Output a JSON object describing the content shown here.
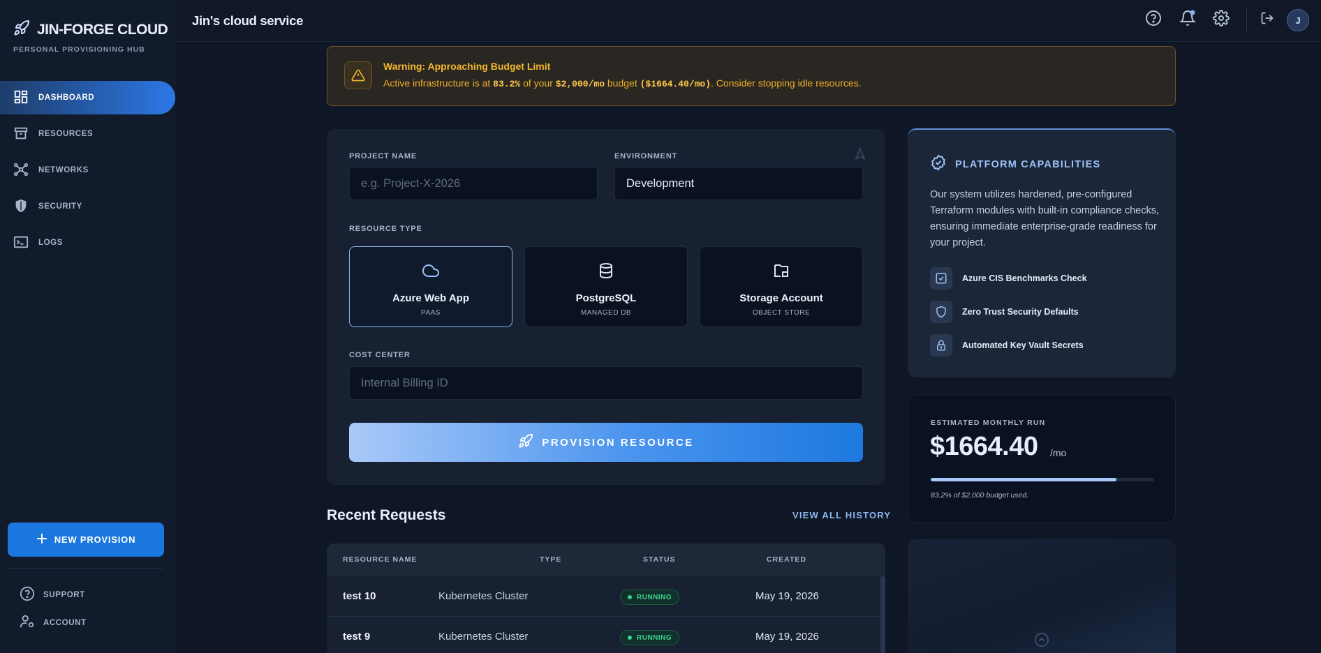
{
  "app": {
    "brand_title": "JIN-FORGE CLOUD",
    "brand_subtitle": "PERSONAL PROVISIONING HUB",
    "header_title": "Jin's cloud service",
    "avatar_initial": "J"
  },
  "sidebar": {
    "items": [
      {
        "label": "DASHBOARD",
        "icon": "dashboard-icon",
        "active": true
      },
      {
        "label": "RESOURCES",
        "icon": "archive-icon",
        "active": false
      },
      {
        "label": "NETWORKS",
        "icon": "network-icon",
        "active": false
      },
      {
        "label": "SECURITY",
        "icon": "shield-icon",
        "active": false
      },
      {
        "label": "LOGS",
        "icon": "terminal-icon",
        "active": false
      }
    ],
    "new_provision": "NEW PROVISION",
    "support": "SUPPORT",
    "account": "ACCOUNT"
  },
  "warning": {
    "title": "Warning: Approaching Budget Limit",
    "text_1": "Active infrastructure is at ",
    "percent": "83.2%",
    "text_2": " of your ",
    "budget": "$2,000/mo",
    "text_3": " budget ",
    "current": "($1664.40/mo)",
    "text_4": ". Consider stopping idle resources."
  },
  "form": {
    "project_label": "PROJECT NAME",
    "project_placeholder": "e.g. Project-X-2026",
    "env_label": "ENVIRONMENT",
    "env_value": "Development",
    "resource_type_label": "RESOURCE TYPE",
    "resource_types": [
      {
        "name": "Azure Web App",
        "sub": "PAAS",
        "selected": true,
        "icon": "cloud-icon"
      },
      {
        "name": "PostgreSQL",
        "sub": "MANAGED DB",
        "selected": false,
        "icon": "database-icon"
      },
      {
        "name": "Storage Account",
        "sub": "OBJECT STORE",
        "selected": false,
        "icon": "folder-icon"
      }
    ],
    "cost_center_label": "COST CENTER",
    "cost_center_placeholder": "Internal Billing ID",
    "submit_label": "PROVISION RESOURCE"
  },
  "recent": {
    "title": "Recent Requests",
    "view_all": "VIEW ALL HISTORY",
    "columns": [
      "RESOURCE NAME",
      "TYPE",
      "STATUS",
      "CREATED"
    ],
    "rows": [
      {
        "name": "test 10",
        "type": "Kubernetes Cluster",
        "status": "RUNNING",
        "created": "May 19, 2026"
      },
      {
        "name": "test 9",
        "type": "Kubernetes Cluster",
        "status": "RUNNING",
        "created": "May 19, 2026"
      }
    ]
  },
  "capabilities": {
    "title": "PLATFORM CAPABILITIES",
    "description": "Our system utilizes hardened, pre-configured Terraform modules with built-in compliance checks, ensuring immediate enterprise-grade readiness for your project.",
    "items": [
      {
        "label": "Azure CIS Benchmarks Check",
        "icon": "checkbox-icon"
      },
      {
        "label": "Zero Trust Security Defaults",
        "icon": "shield-outline-icon"
      },
      {
        "label": "Automated Key Vault Secrets",
        "icon": "lock-icon"
      }
    ]
  },
  "cost": {
    "label": "ESTIMATED MONTHLY RUN",
    "value": "$1664.40",
    "unit": "/mo",
    "budget_used_fraction": 0.832,
    "note": "83.2% of $2,000 budget used."
  },
  "colors": {
    "accent": "#1a77dd",
    "warning": "#f5b82e",
    "success": "#3cd28f"
  }
}
